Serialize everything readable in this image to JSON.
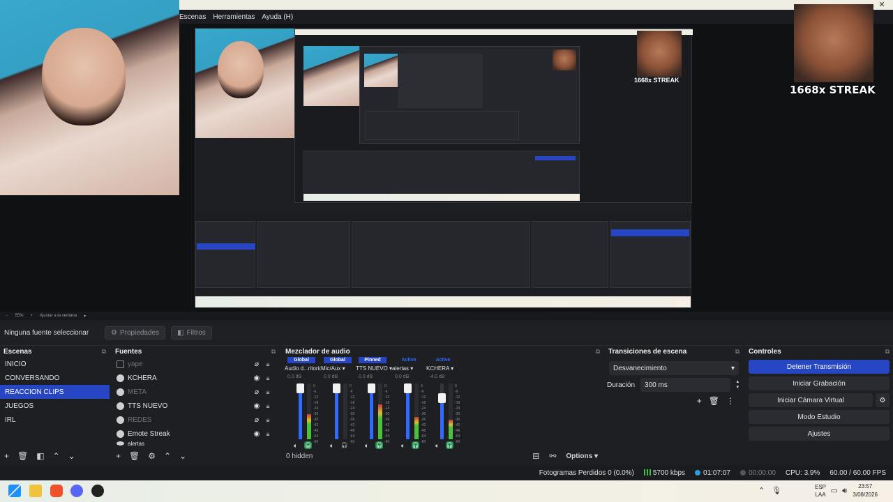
{
  "menu": {
    "items": [
      "Escenas",
      "Herramientas",
      "Ayuda (H)"
    ]
  },
  "overlay": {
    "streak": "1668x STREAK"
  },
  "preview_footer": {
    "zoom_minus": "−",
    "zoom": "55%",
    "zoom_plus": "+",
    "fit": "Ajustar a la ventana"
  },
  "source_bar": {
    "no_source": "Ninguna fuente seleccionar",
    "properties": "Propiedades",
    "filters": "Filtros"
  },
  "scenes": {
    "title": "Escenas",
    "items": [
      {
        "label": "INICIO"
      },
      {
        "label": "CONVERSANDO"
      },
      {
        "label": "REACCION CLIPS"
      },
      {
        "label": "JUEGOS"
      },
      {
        "label": "IRL"
      }
    ],
    "selected": "REACCION CLIPS"
  },
  "sources": {
    "title": "Fuentes",
    "items": [
      {
        "label": "yape",
        "visible": false
      },
      {
        "label": "KCHERA",
        "visible": true
      },
      {
        "label": "META",
        "visible": false
      },
      {
        "label": "TTS NUEVO",
        "visible": true
      },
      {
        "label": "REDES",
        "visible": false
      },
      {
        "label": "Emote Streak",
        "visible": true
      },
      {
        "label": "alertas",
        "visible": true
      }
    ]
  },
  "mixer": {
    "title": "Mezclador de audio",
    "hidden": "0 hidden",
    "options": "Options",
    "channels": [
      {
        "badge": "Global",
        "name": "Audio d...ritorio",
        "db": "0.0 dB",
        "level": 1.0,
        "meter": 0.45,
        "monitor": true
      },
      {
        "badge": "Global",
        "name": "Mic/Aux",
        "db": "0.0 dB",
        "level": 1.0,
        "meter": 0.0,
        "monitor": false
      },
      {
        "badge": "Pinned",
        "name": "TTS NUEVO",
        "db": "0.0 dB",
        "level": 1.0,
        "meter": 0.62,
        "monitor": true
      },
      {
        "badge": "Active",
        "name": "alertas",
        "db": "0.0 dB",
        "level": 1.0,
        "meter": 0.4,
        "monitor": true
      },
      {
        "badge": "Active",
        "name": "KCHERA",
        "db": "-4.0 dB",
        "level": 0.8,
        "meter": 0.35,
        "monitor": true
      }
    ],
    "scale": [
      "0",
      "-6",
      "-12",
      "-18",
      "-24",
      "-30",
      "-36",
      "-42",
      "-48",
      "-54",
      "-60"
    ]
  },
  "transitions": {
    "title": "Transiciones de escena",
    "type": "Desvanecimiento",
    "duration_label": "Duración",
    "duration": "300 ms"
  },
  "controls": {
    "title": "Controles",
    "stop_stream": "Detener Transmisión",
    "start_rec": "Iniciar Grabación",
    "virtual_cam": "Iniciar Cámara Virtual",
    "studio": "Modo Estudio",
    "settings": "Ajustes"
  },
  "status": {
    "dropped": "Fotogramas Perdidos 0 (0.0%)",
    "kbps": "5700 kbps",
    "stream_time": "01:07:07",
    "rec_time": "00:00:00",
    "cpu": "CPU: 3.9%",
    "fps": "60.00 / 60.00 FPS"
  },
  "taskbar": {
    "lang1": "ESP",
    "lang2": "LAA",
    "time": "23:57",
    "date": "3/08/2026"
  },
  "colors": {
    "accent": "#2746c4",
    "meter_green": "#4cbf3c",
    "bg": "#1e1f23"
  }
}
